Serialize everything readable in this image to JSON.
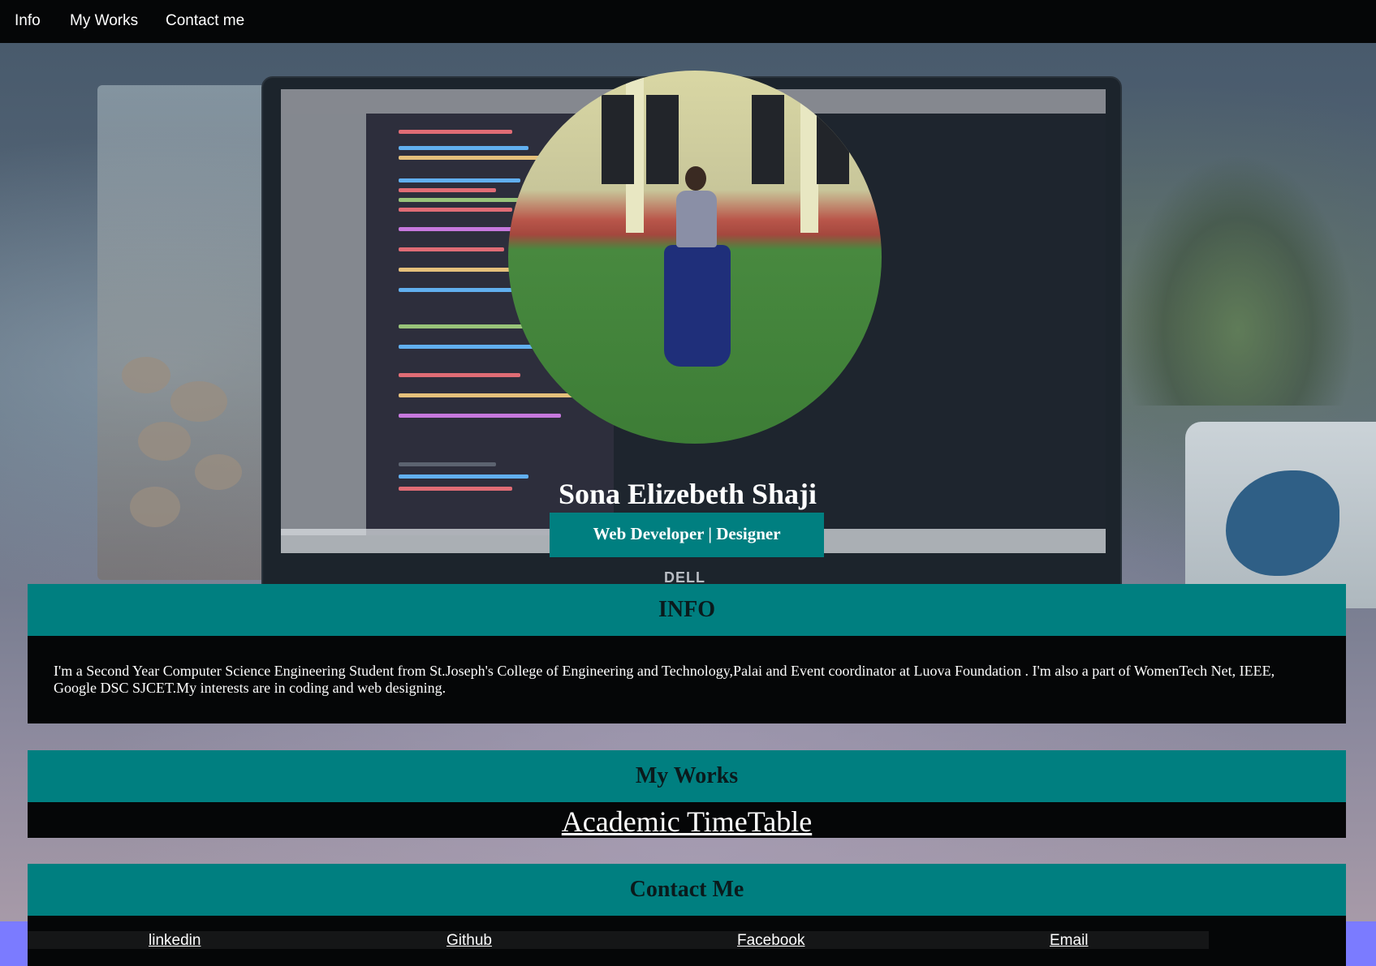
{
  "nav": {
    "links": [
      {
        "label": "Info"
      },
      {
        "label": "My Works"
      },
      {
        "label": "Contact me"
      }
    ]
  },
  "profile": {
    "name": "Sona Elizebeth Shaji",
    "tagline": "Web Developer | Designer",
    "background_brand": "DELL"
  },
  "info": {
    "heading": "INFO",
    "text": "I'm a Second Year Computer Science Engineering Student from St.Joseph's College of Engineering and Technology,Palai and Event coordinator at Luova Foundation . I'm also a part of WomenTech Net, IEEE, Google DSC SJCET.My interests are in coding and web designing."
  },
  "works": {
    "heading": "My Works",
    "items": [
      {
        "label": "Academic TimeTable"
      }
    ]
  },
  "contact": {
    "heading": "Contact Me",
    "links": [
      {
        "label": "linkedin"
      },
      {
        "label": "Github"
      },
      {
        "label": "Facebook"
      },
      {
        "label": "Email"
      }
    ]
  },
  "colors": {
    "nav_bg": "#050607",
    "section_teal": "#007f80",
    "body_black": "#050607",
    "page_bottom_blue": "#7b7bff"
  }
}
